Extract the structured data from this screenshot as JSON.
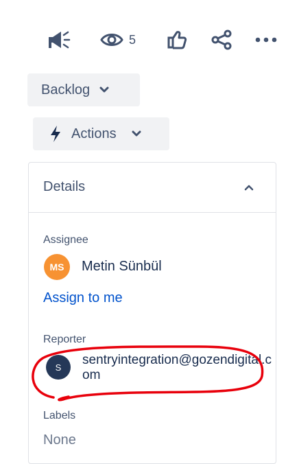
{
  "toolbar": {
    "watch_count": "5"
  },
  "status_button": {
    "label": "Backlog"
  },
  "actions_button": {
    "label": "Actions"
  },
  "details": {
    "title": "Details",
    "assignee": {
      "label": "Assignee",
      "avatar_initials": "MS",
      "avatar_color": "#f79232",
      "name": "Metin Sünbül",
      "assign_link": "Assign to me"
    },
    "reporter": {
      "label": "Reporter",
      "avatar_initials": "S",
      "avatar_color": "#253858",
      "name": "sentryintegration@gozendigital.com"
    },
    "labels": {
      "label": "Labels",
      "value": "None"
    }
  },
  "colors": {
    "link": "#0052cc",
    "annotation": "#e8000b",
    "text_subtle": "#42526e"
  },
  "icons": [
    "megaphone-icon",
    "eye-icon",
    "thumbs-up-icon",
    "share-icon",
    "more-icon",
    "chevron-down-icon",
    "lightning-icon",
    "chevron-up-icon"
  ]
}
